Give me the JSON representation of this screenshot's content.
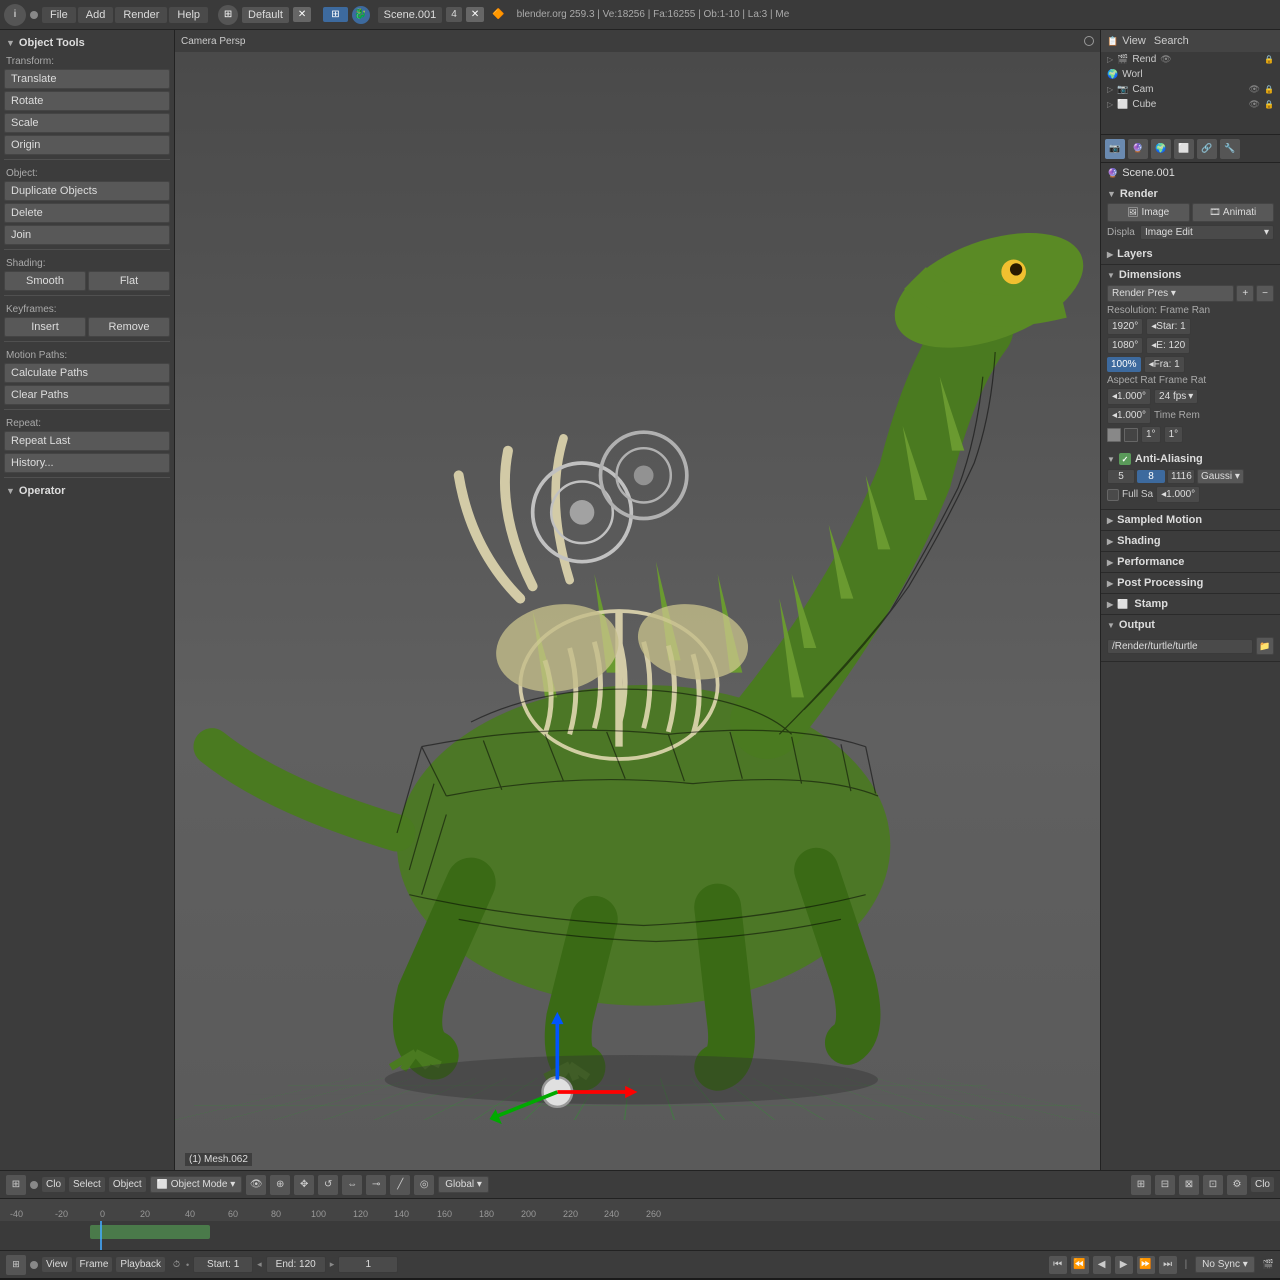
{
  "topbar": {
    "icon_label": "i",
    "menu_items": [
      "File",
      "Add",
      "Render",
      "Help"
    ],
    "layout_label": "Default",
    "scene_label": "Scene.001",
    "tab_num": "4",
    "blender_icon": "🔶",
    "info_text": "blender.org 259.3 | Ve:18256 | Fa:16255 | Ob:1-10 | La:3 | Me",
    "view_label": "View",
    "search_label": "Search"
  },
  "left_panel": {
    "title": "Object Tools",
    "transform_label": "Transform:",
    "translate_btn": "Translate",
    "rotate_btn": "Rotate",
    "scale_btn": "Scale",
    "origin_btn": "Origin",
    "object_label": "Object:",
    "duplicate_btn": "Duplicate Objects",
    "delete_btn": "Delete",
    "join_btn": "Join",
    "shading_label": "Shading:",
    "smooth_btn": "Smooth",
    "flat_btn": "Flat",
    "keyframes_label": "Keyframes:",
    "insert_btn": "Insert",
    "remove_btn": "Remove",
    "motion_label": "Motion Paths:",
    "calc_paths_btn": "Calculate Paths",
    "clear_paths_btn": "Clear Paths",
    "repeat_label": "Repeat:",
    "repeat_last_btn": "Repeat Last",
    "history_btn": "History...",
    "operator_label": "Operator"
  },
  "viewport": {
    "camera_label": "Camera Persp",
    "mesh_label": "(1) Mesh.062"
  },
  "outliner": {
    "view_label": "View",
    "search_label": "Search",
    "items": [
      {
        "name": "Rend",
        "icon": "camera"
      },
      {
        "name": "Worl",
        "icon": "world"
      },
      {
        "name": "Cam",
        "icon": "camera2"
      },
      {
        "name": "Cube",
        "icon": "cube"
      }
    ]
  },
  "properties": {
    "scene_name": "Scene.001",
    "render_label": "Render",
    "image_btn": "Image",
    "animati_btn": "Animati",
    "displa_label": "Displa",
    "image_edit_btn": "Image Edit",
    "layers_label": "Layers",
    "dimensions_label": "Dimensions",
    "render_pres_btn": "Render Pres",
    "resolution_label": "Resolution:",
    "frame_ran_label": "Frame Ran",
    "res_x": "1920°",
    "res_y": "1080°",
    "res_pct": "100%",
    "star1": "◂Star: 1",
    "e120": "◂E: 120",
    "fra1": "◂Fra: 1",
    "aspect_rat_label": "Aspect Rat",
    "frame_rat_label": "Frame Rat",
    "asp_x": "◂1.000°",
    "asp_y": "◂1.000°",
    "fps": "24 fps",
    "time_rem_label": "Time Rem",
    "time_1a": "1°",
    "time_1b": "1°",
    "anti_alias_label": "Anti-Aliasing",
    "aa_5": "5",
    "aa_8": "8",
    "aa_1116": "1116",
    "gauss_label": "Gaussi",
    "full_sa_label": "Full Sa",
    "full_sa_val": "◂1.000°",
    "sampled_motion_label": "Sampled Motion",
    "shading_label": "Shading",
    "performance_label": "Performance",
    "post_processing_label": "Post Processing",
    "stamp_label": "Stamp",
    "output_label": "Output",
    "output_path": "/Render/turtle/turtle"
  },
  "bottom_toolbar": {
    "mode_options": [
      "Object Mode"
    ],
    "current_mode": "Object Mode",
    "transform_label": "Global",
    "close_label": "Clo"
  },
  "timeline": {
    "markers": [
      "-40",
      "-20",
      "0",
      "20",
      "40",
      "60",
      "80",
      "100",
      "120",
      "140",
      "160",
      "180",
      "200",
      "220",
      "240",
      "260"
    ]
  },
  "playback": {
    "view_label": "View",
    "frame_label": "Frame",
    "playback_label": "Playback",
    "start_label": "Start: 1",
    "end_label": "End: 120",
    "current_frame": "1",
    "sync_label": "No Sync"
  }
}
